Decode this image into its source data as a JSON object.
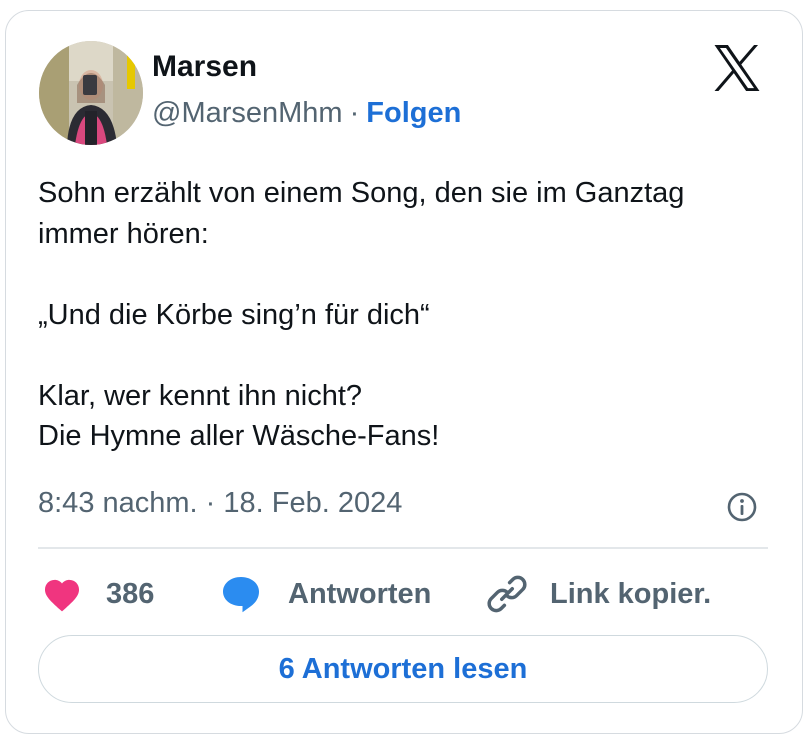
{
  "author": {
    "name": "Marsen",
    "handle": "@MarsenMhm",
    "separator": "·",
    "follow_label": "Folgen"
  },
  "tweet": {
    "lines": [
      "Sohn erzählt von einem Song, den sie im Ganztag",
      "immer hören:",
      "„Und die Körbe sing’n für dich“",
      "Klar, wer kennt ihn nicht?",
      "Die Hymne aller Wäsche-Fans!"
    ],
    "timestamp": "8:43 nachm. · 18. Feb. 2024"
  },
  "actions": {
    "like_count": "386",
    "reply_label": "Antworten",
    "copy_label": "Link kopier."
  },
  "read_replies_label": "6 Antworten lesen",
  "icons": {
    "brand": "x-logo-icon",
    "info": "info-icon",
    "like": "heart-icon",
    "reply": "speech-bubble-icon",
    "copy": "link-icon"
  },
  "colors": {
    "accent": "#1d6fd6",
    "heart": "#f0357f",
    "reply_bubble": "#2b8cf0",
    "secondary_text": "#536471",
    "border": "#d6dbe0"
  }
}
